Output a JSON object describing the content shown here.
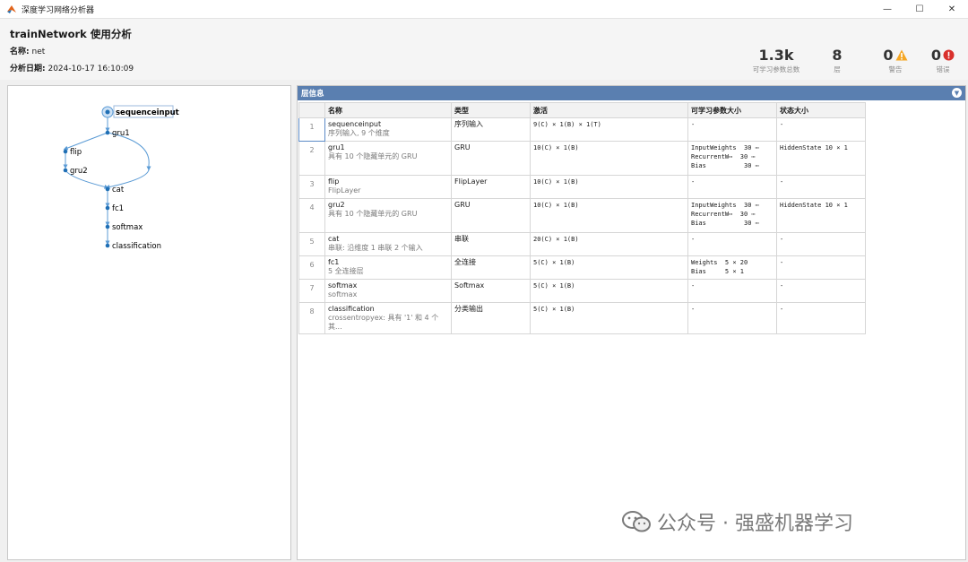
{
  "window": {
    "title": "深度学习网络分析器",
    "controls": [
      "—",
      "☐",
      "✕"
    ]
  },
  "header": {
    "title": "trainNetwork 使用分析",
    "name_label": "名称:",
    "name_value": "net",
    "date_label": "分析日期:",
    "date_value": "2024-10-17 16:10:09",
    "stats": [
      {
        "value": "1.3k",
        "label": "可学习参数总数"
      },
      {
        "value": "8",
        "label": "层"
      },
      {
        "value": "0",
        "label": "警告"
      },
      {
        "value": "0",
        "label": "错误"
      }
    ],
    "colors": {
      "warning": "#f5a623",
      "error": "#d9302c"
    }
  },
  "graph": {
    "nodes": [
      "sequenceinput",
      "gru1",
      "flip",
      "gru2",
      "cat",
      "fc1",
      "softmax",
      "classification"
    ],
    "colors": {
      "node": "#1f6fb5",
      "edge": "#5b9bd5"
    }
  },
  "layer_panel": {
    "title": "层信息",
    "columns": [
      "",
      "名称",
      "类型",
      "激活",
      "可学习参数大小",
      "状态大小"
    ],
    "rows": [
      {
        "index": "1",
        "name": "sequenceinput",
        "desc": "序列输入, 9 个维度",
        "type": "序列输入",
        "activation": "9(C) × 1(B) × 1(T)",
        "learnables": [
          "-"
        ],
        "state": "-"
      },
      {
        "index": "2",
        "name": "gru1",
        "desc": "具有 10 个隐藏单元的 GRU",
        "type": "GRU",
        "activation": "10(C) × 1(B)",
        "learnables": [
          "InputWeights  30 ⋯",
          "RecurrentW⋯  30 ⋯",
          "Bias          30 ⋯"
        ],
        "state": "HiddenState  10 × 1"
      },
      {
        "index": "3",
        "name": "flip",
        "desc": "FlipLayer",
        "type": "FlipLayer",
        "activation": "10(C) × 1(B)",
        "learnables": [
          "-"
        ],
        "state": "-"
      },
      {
        "index": "4",
        "name": "gru2",
        "desc": "具有 10 个隐藏单元的 GRU",
        "type": "GRU",
        "activation": "10(C) × 1(B)",
        "learnables": [
          "InputWeights  30 ⋯",
          "RecurrentW⋯  30 ⋯",
          "Bias          30 ⋯"
        ],
        "state": "HiddenState  10 × 1"
      },
      {
        "index": "5",
        "name": "cat",
        "desc": "串联: 沿维度 1 串联 2 个输入",
        "type": "串联",
        "activation": "20(C) × 1(B)",
        "learnables": [
          "-"
        ],
        "state": "-"
      },
      {
        "index": "6",
        "name": "fc1",
        "desc": "5 全连接层",
        "type": "全连接",
        "activation": "5(C) × 1(B)",
        "learnables": [
          "Weights  5 × 20",
          "Bias     5 × 1"
        ],
        "state": "-"
      },
      {
        "index": "7",
        "name": "softmax",
        "desc": "softmax",
        "type": "Softmax",
        "activation": "5(C) × 1(B)",
        "learnables": [
          "-"
        ],
        "state": "-"
      },
      {
        "index": "8",
        "name": "classification",
        "desc": "crossentropyex: 具有 '1' 和 4 个其...",
        "type": "分类输出",
        "activation": "5(C) × 1(B)",
        "learnables": [
          "-"
        ],
        "state": "-"
      }
    ]
  },
  "watermark": {
    "text": "公众号 · 强盛机器学习"
  }
}
